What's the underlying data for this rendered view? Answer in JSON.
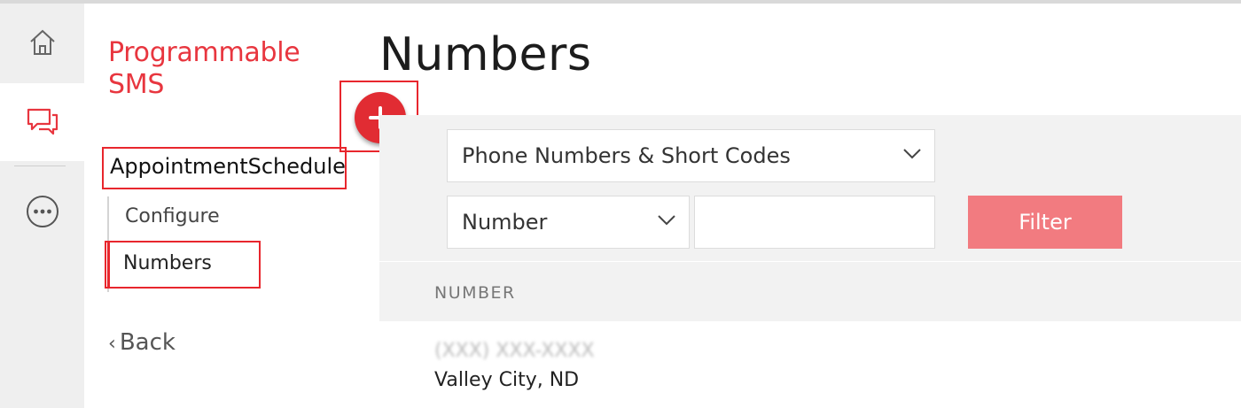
{
  "product": {
    "title_line1": "Programmable",
    "title_line2": "SMS"
  },
  "rail": {
    "home_icon": "home-icon",
    "sms_icon": "chat-bubbles-icon",
    "more_icon": "more-icon"
  },
  "sidebar": {
    "app_name": "AppointmentScheduler",
    "items": [
      {
        "label": "Configure"
      },
      {
        "label": "Numbers"
      }
    ],
    "back_label": "Back"
  },
  "main": {
    "title": "Numbers",
    "type_select": "Phone Numbers & Short Codes",
    "field_select": "Number",
    "search_value": "",
    "filter_label": "Filter",
    "column_number": "NUMBER",
    "rows": [
      {
        "number": "(XXX) XXX-XXXX",
        "location": "Valley City, ND"
      }
    ]
  },
  "colors": {
    "accent": "#e8363f",
    "filter_button": "#f27b80",
    "panel_bg": "#f2f2f2"
  }
}
